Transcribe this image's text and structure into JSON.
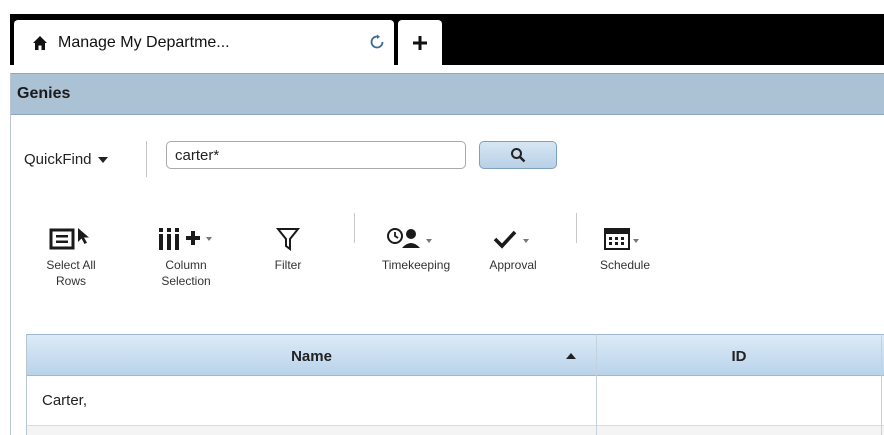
{
  "tabs": {
    "active_title": "Manage My Departme...",
    "add_label": "+"
  },
  "header": {
    "title": "Genies"
  },
  "quickfind": {
    "label": "QuickFind",
    "value": "carter*"
  },
  "toolbar": {
    "select_all": [
      "Select All",
      "Rows"
    ],
    "column_selection": [
      "Column",
      "Selection"
    ],
    "filter": "Filter",
    "timekeeping": "Timekeeping",
    "approval": "Approval",
    "schedule": "Schedule"
  },
  "grid": {
    "columns": [
      "Name",
      "ID"
    ],
    "rows": [
      {
        "name": "Carter,",
        "id": ""
      }
    ]
  },
  "colors": {
    "header_bar": "#abc1d4",
    "grid_header": "#b9d3ea",
    "tabstrip": "#000000"
  }
}
